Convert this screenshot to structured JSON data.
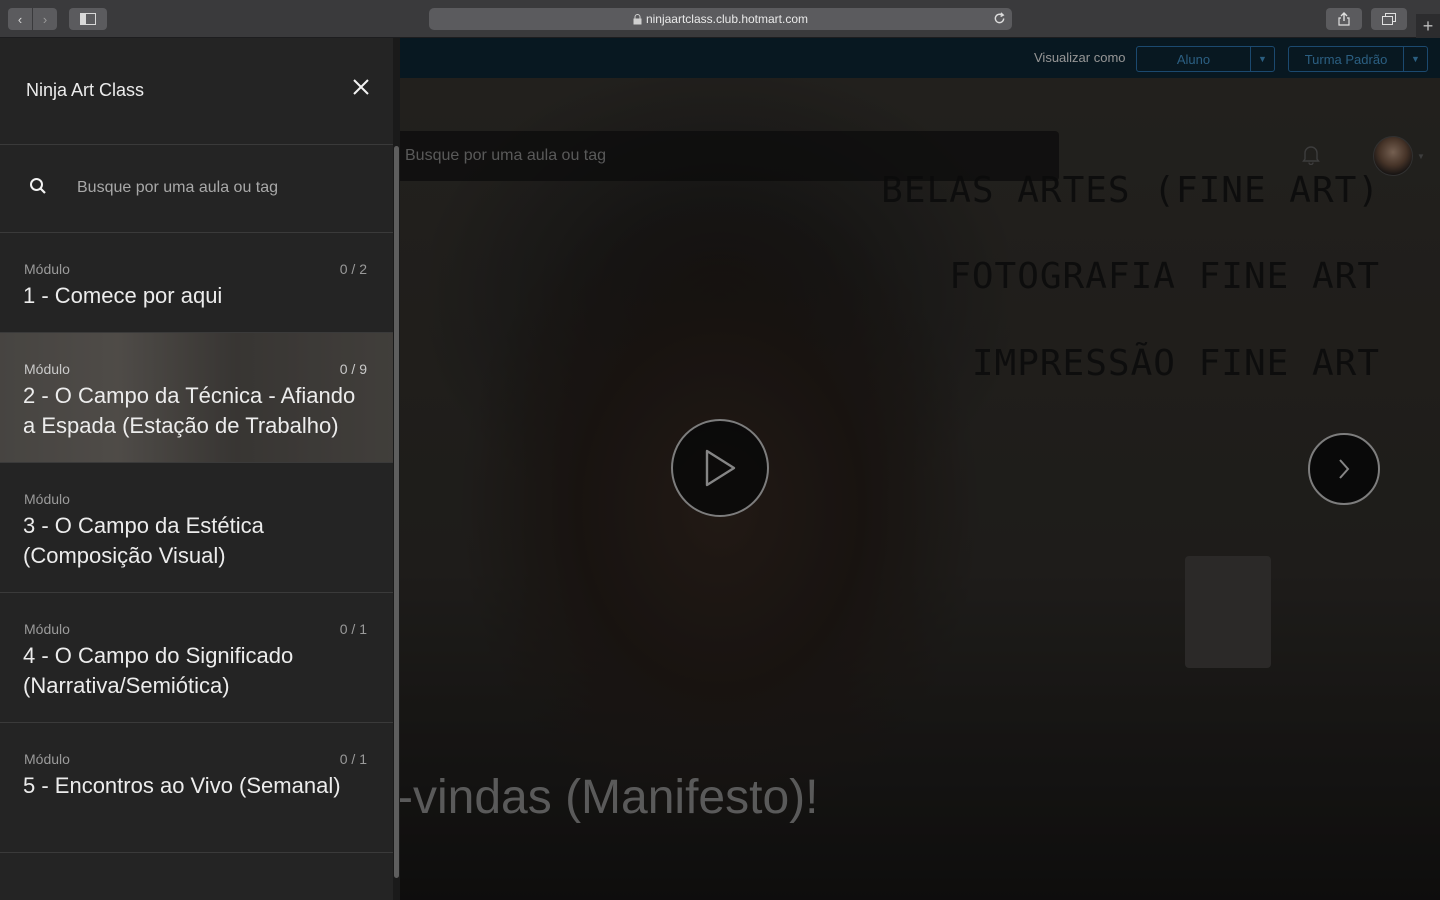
{
  "browser": {
    "url": "ninjaartclass.club.hotmart.com",
    "back_glyph": "‹",
    "forward_glyph": "›",
    "new_tab_glyph": "+"
  },
  "topbar": {
    "view_as_label": "Visualizar como",
    "role_value": "Aluno",
    "class_value": "Turma Padrão"
  },
  "hero": {
    "search_placeholder": "Busque por uma aula ou tag",
    "bg_lines": [
      "BELAS ARTES (FINE ART)",
      "FOTOGRAFIA FINE ART",
      "IMPRESSÃO FINE ART"
    ],
    "title": "-vindas (Manifesto)!"
  },
  "sidebar": {
    "brand": "Ninja Art Class",
    "search_placeholder": "Busque por uma aula ou tag",
    "modules": [
      {
        "label": "Módulo",
        "title": "1 - Comece por aqui",
        "progress": "0 / 2"
      },
      {
        "label": "Módulo",
        "title": "2 - O Campo da Técnica - Afiando a Espada (Estação de Trabalho)",
        "progress": "0 / 9"
      },
      {
        "label": "Módulo",
        "title": "3 - O Campo da Estética (Composição Visual)",
        "progress": ""
      },
      {
        "label": "Módulo",
        "title": "4 - O Campo do Significado (Narrativa/Semiótica)",
        "progress": "0 / 1"
      },
      {
        "label": "Módulo",
        "title": "5 - Encontros ao Vivo (Semanal)",
        "progress": "0 / 1"
      }
    ]
  },
  "colors": {
    "sidebar_bg": "#242424",
    "topbar_bg": "#0f2a39",
    "accent_blue": "#4aa3df"
  }
}
